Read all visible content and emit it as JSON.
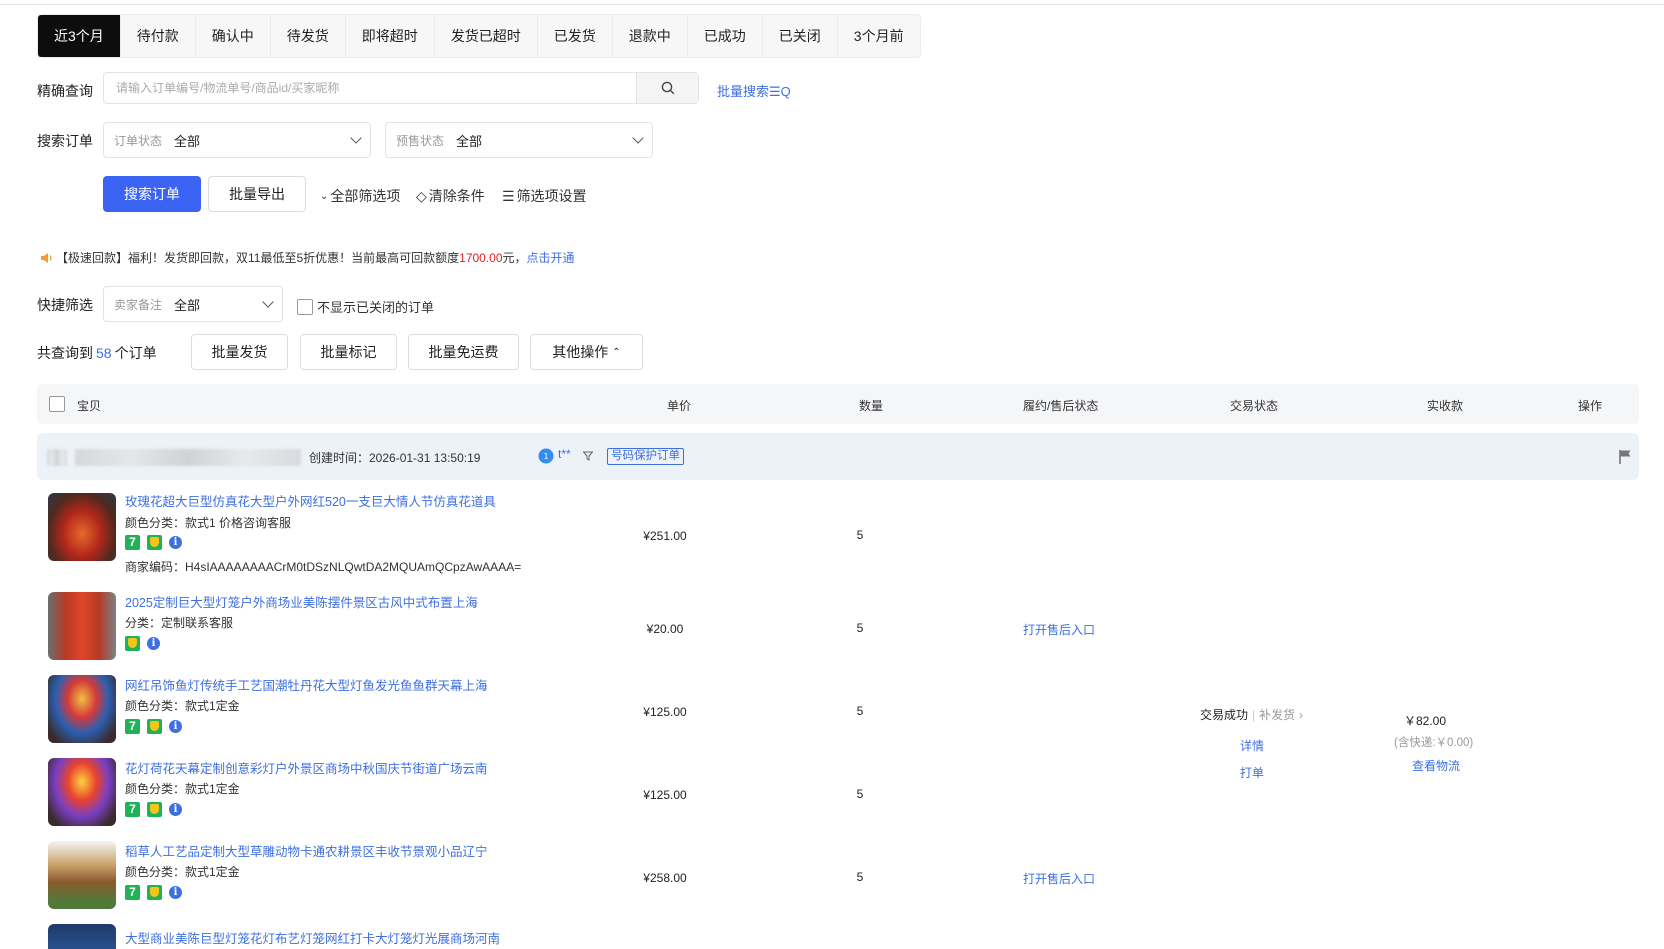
{
  "tabs": [
    "近3个月",
    "待付款",
    "确认中",
    "待发货",
    "即将超时",
    "发货已超时",
    "已发货",
    "退款中",
    "已成功",
    "已关闭",
    "3个月前"
  ],
  "search": {
    "label": "精确查询",
    "placeholder": "请输入订单编号/物流单号/商品id/买家昵称",
    "batch_link": "批量搜索☰Q"
  },
  "filters": {
    "label": "搜索订单",
    "order_status_label": "订单状态",
    "order_status_value": "全部",
    "presale_status_label": "预售状态",
    "presale_status_value": "全部"
  },
  "actions": {
    "search_button": "搜索订单",
    "export_button": "批量导出",
    "all_filters": "全部筛选项",
    "clear": "清除条件",
    "filter_settings": "筛选项设置"
  },
  "notice": {
    "prefix": "【极速回款】福利！发货即回款，双11最低至5折优惠！当前最高可回款额度",
    "amount": "1700.00",
    "suffix": "元，",
    "link": "点击开通"
  },
  "quick": {
    "label": "快捷筛选",
    "seller_note_label": "卖家备注",
    "seller_note_value": "全部",
    "hide_closed": "不显示已关闭的订单"
  },
  "summary": {
    "prefix": "共查询到",
    "count": "58",
    "suffix": "个订单"
  },
  "bulk": {
    "ship": "批量发货",
    "mark": "批量标记",
    "free_shipping": "批量免运费",
    "other": "其他操作"
  },
  "table_header": {
    "item": "宝贝",
    "unit_price": "单价",
    "quantity": "数量",
    "fulfillment": "履约/售后状态",
    "trade_status": "交易状态",
    "received": "实收款",
    "operation": "操作"
  },
  "order": {
    "created_time": "创建时间：2026-01-31 13:50:19",
    "buyer": "t**",
    "protect_tag": "号码保护订单",
    "trade_status": "交易成功",
    "resend": "补发货",
    "detail_link": "详情",
    "print_link": "打单",
    "amount": "￥82.00",
    "shipping_note": "(含快递:￥0.00)",
    "logistics_link": "查看物流",
    "items": [
      {
        "title": "玫瑰花超大巨型仿真花大型户外网红520一支巨大情人节仿真花道具",
        "sku": "颜色分类：款式1 价格咨询客服",
        "merchant_code": "商家编码：H4sIAAAAAAAACrM0tDSzNLQwtDA2MQUAmQCpzAwAAAA=",
        "price": "¥251.00",
        "qty": "5",
        "after_sale": ""
      },
      {
        "title": "2025定制巨大型灯笼户外商场业美陈摆件景区古风中式布置上海",
        "sku": "分类：定制联系客服",
        "price": "¥20.00",
        "qty": "5",
        "after_sale": "打开售后入口"
      },
      {
        "title": "网红吊饰鱼灯传统手工艺国潮牡丹花大型灯鱼发光鱼鱼群天幕上海",
        "sku": "颜色分类：款式1定金",
        "price": "¥125.00",
        "qty": "5",
        "after_sale": ""
      },
      {
        "title": "花灯荷花天幕定制创意彩灯户外景区商场中秋国庆节街道广场云南",
        "sku": "颜色分类：款式1定金",
        "price": "¥125.00",
        "qty": "5",
        "after_sale": ""
      },
      {
        "title": "稻草人工艺品定制大型草雕动物卡通农耕景区丰收节景观小品辽宁",
        "sku": "颜色分类：款式1定金",
        "price": "¥258.00",
        "qty": "5",
        "after_sale": "打开售后入口"
      },
      {
        "title": "大型商业美陈巨型灯笼花灯布艺灯笼网红打卡大灯笼灯光展商场河南",
        "sku": "",
        "price": "",
        "qty": "",
        "after_sale": ""
      }
    ]
  },
  "colors": {
    "accent": "#3b63f4",
    "link": "#3d6fe0",
    "badge_green": "#1fb257",
    "highlight_red": "#e02020"
  },
  "icons": [
    "search-icon",
    "speaker-icon",
    "filter-icon",
    "flag-icon",
    "seven-day-return-icon",
    "guarantee-icon",
    "info-icon"
  ]
}
